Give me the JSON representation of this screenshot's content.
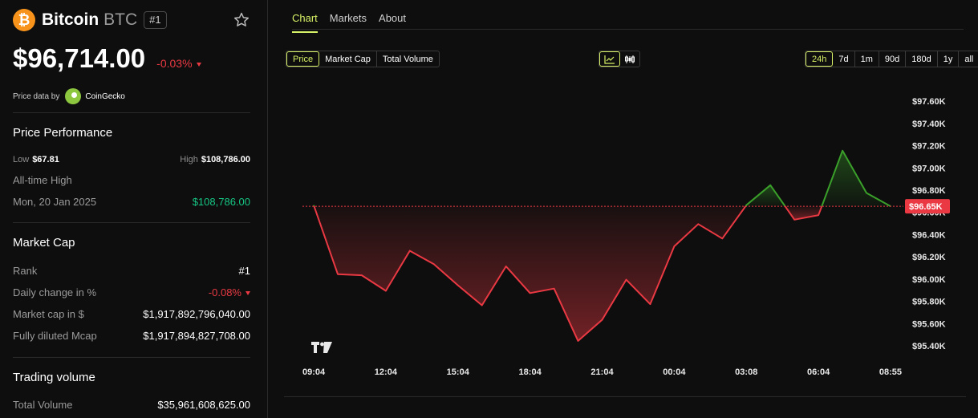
{
  "coin": {
    "logo_glyph": "₿",
    "name": "Bitcoin",
    "symbol": "BTC",
    "rank_badge": "#1",
    "price": "$96,714.00",
    "change_24h": "-0.03%",
    "price_data_label": "Price data by",
    "price_data_source": "CoinGecko"
  },
  "price_performance": {
    "title": "Price Performance",
    "low_label": "Low",
    "low_value": "$67.81",
    "high_label": "High",
    "high_value": "$108,786.00",
    "ath_label": "All-time High",
    "ath_date": "Mon, 20 Jan 2025",
    "ath_value": "$108,786.00"
  },
  "market_cap": {
    "title": "Market Cap",
    "rows": [
      {
        "label": "Rank",
        "value": "#1"
      },
      {
        "label": "Daily change in %",
        "value": "-0.08%"
      },
      {
        "label": "Market cap in $",
        "value": "$1,917,892,796,040.00"
      },
      {
        "label": "Fully diluted Mcap",
        "value": "$1,917,894,827,708.00"
      }
    ]
  },
  "trading_volume": {
    "title": "Trading volume",
    "rows": [
      {
        "label": "Total Volume",
        "value": "$35,961,608,625.00"
      }
    ]
  },
  "tabs": [
    {
      "label": "Chart",
      "active": true
    },
    {
      "label": "Markets",
      "active": false
    },
    {
      "label": "About",
      "active": false
    }
  ],
  "metric_options": [
    {
      "label": "Price",
      "active": true
    },
    {
      "label": "Market Cap",
      "active": false
    },
    {
      "label": "Total Volume",
      "active": false
    }
  ],
  "chart_style_options": [
    {
      "icon": "line-chart-icon",
      "active": true
    },
    {
      "icon": "candlestick-icon",
      "active": false
    }
  ],
  "range_options": [
    {
      "label": "24h",
      "active": true
    },
    {
      "label": "7d",
      "active": false
    },
    {
      "label": "1m",
      "active": false
    },
    {
      "label": "90d",
      "active": false
    },
    {
      "label": "180d",
      "active": false
    },
    {
      "label": "1y",
      "active": false
    },
    {
      "label": "all",
      "active": false
    }
  ],
  "colors": {
    "accent": "#d7f266",
    "up": "#3aa02a",
    "down": "#ea3943",
    "brand": "#f7931a"
  },
  "chart_data": {
    "type": "line",
    "x_tick_labels": [
      "09:04",
      "12:04",
      "15:04",
      "18:04",
      "21:04",
      "00:04",
      "03:08",
      "06:04",
      "08:55"
    ],
    "y_tick_labels": [
      "$97.60K",
      "$97.40K",
      "$97.20K",
      "$97.00K",
      "$96.80K",
      "$96.60K",
      "$96.40K",
      "$96.20K",
      "$96.00K",
      "$95.80K",
      "$95.60K",
      "$95.40K"
    ],
    "y_ticks": [
      97600,
      97400,
      97200,
      97000,
      96800,
      96600,
      96400,
      96200,
      96000,
      95800,
      95600,
      95400
    ],
    "ylim": [
      95300,
      97680
    ],
    "baseline_value": 96655,
    "current_price_label": "$96.65K",
    "x_span_hours": 24,
    "points": [
      {
        "h": 0.0,
        "v": 96665
      },
      {
        "h": 1.0,
        "v": 96045
      },
      {
        "h": 2.0,
        "v": 96035
      },
      {
        "h": 3.0,
        "v": 95895
      },
      {
        "h": 4.0,
        "v": 96255
      },
      {
        "h": 5.0,
        "v": 96135
      },
      {
        "h": 6.0,
        "v": 95945
      },
      {
        "h": 7.0,
        "v": 95765
      },
      {
        "h": 8.0,
        "v": 96115
      },
      {
        "h": 9.0,
        "v": 95875
      },
      {
        "h": 10.0,
        "v": 95915
      },
      {
        "h": 11.0,
        "v": 95445
      },
      {
        "h": 12.0,
        "v": 95635
      },
      {
        "h": 13.0,
        "v": 95995
      },
      {
        "h": 14.0,
        "v": 95775
      },
      {
        "h": 15.0,
        "v": 96295
      },
      {
        "h": 16.0,
        "v": 96495
      },
      {
        "h": 17.0,
        "v": 96365
      },
      {
        "h": 18.0,
        "v": 96665
      },
      {
        "h": 19.0,
        "v": 96845
      },
      {
        "h": 20.0,
        "v": 96535
      },
      {
        "h": 21.0,
        "v": 96575
      },
      {
        "h": 22.0,
        "v": 97155
      },
      {
        "h": 23.0,
        "v": 96775
      },
      {
        "h": 24.0,
        "v": 96655
      }
    ]
  }
}
